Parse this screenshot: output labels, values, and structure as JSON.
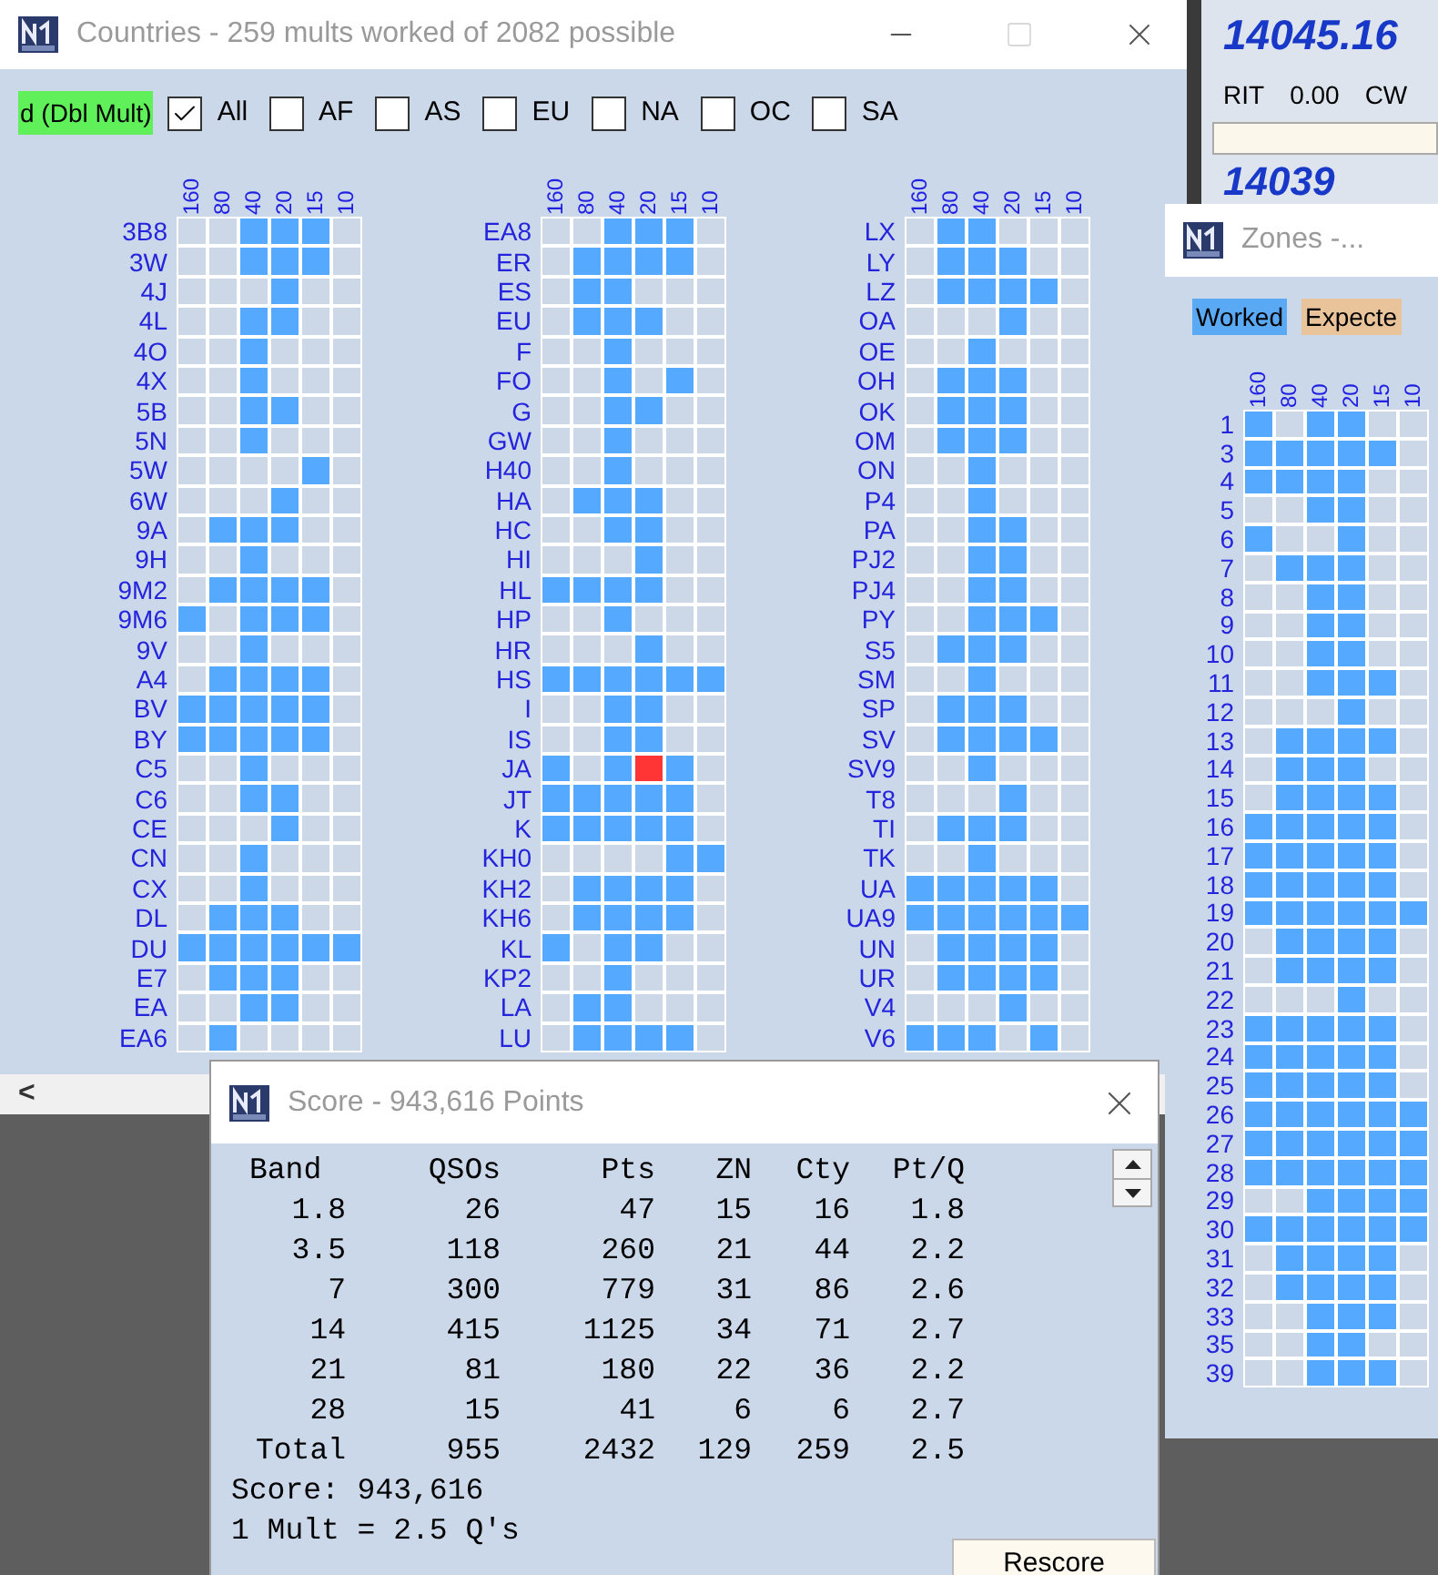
{
  "countries_window": {
    "title": "Countries - 259 mults worked of 2082 possible",
    "filter_label": "d (Dbl Mult)",
    "filters": [
      {
        "label": "All",
        "checked": true
      },
      {
        "label": "AF",
        "checked": false
      },
      {
        "label": "AS",
        "checked": false
      },
      {
        "label": "EU",
        "checked": false
      },
      {
        "label": "NA",
        "checked": false
      },
      {
        "label": "OC",
        "checked": false
      },
      {
        "label": "SA",
        "checked": false
      }
    ],
    "columns": [
      {
        "band_headers": [
          "160",
          "80",
          "40",
          "20",
          "15",
          "10"
        ],
        "rows": [
          {
            "name": "3B8",
            "worked": [
              false,
              false,
              true,
              true,
              true,
              false
            ]
          },
          {
            "name": "3W",
            "worked": [
              false,
              false,
              true,
              true,
              true,
              false
            ]
          },
          {
            "name": "4J",
            "worked": [
              false,
              false,
              false,
              true,
              false,
              false
            ]
          },
          {
            "name": "4L",
            "worked": [
              false,
              false,
              true,
              true,
              false,
              false
            ]
          },
          {
            "name": "4O",
            "worked": [
              false,
              false,
              true,
              false,
              false,
              false
            ]
          },
          {
            "name": "4X",
            "worked": [
              false,
              false,
              true,
              false,
              false,
              false
            ]
          },
          {
            "name": "5B",
            "worked": [
              false,
              false,
              true,
              true,
              false,
              false
            ]
          },
          {
            "name": "5N",
            "worked": [
              false,
              false,
              true,
              false,
              false,
              false
            ]
          },
          {
            "name": "5W",
            "worked": [
              false,
              false,
              false,
              false,
              true,
              false
            ]
          },
          {
            "name": "6W",
            "worked": [
              false,
              false,
              false,
              true,
              false,
              false
            ]
          },
          {
            "name": "9A",
            "worked": [
              false,
              true,
              true,
              true,
              false,
              false
            ]
          },
          {
            "name": "9H",
            "worked": [
              false,
              false,
              true,
              false,
              false,
              false
            ]
          },
          {
            "name": "9M2",
            "worked": [
              false,
              true,
              true,
              true,
              true,
              false
            ]
          },
          {
            "name": "9M6",
            "worked": [
              true,
              false,
              true,
              true,
              true,
              false
            ]
          },
          {
            "name": "9V",
            "worked": [
              false,
              false,
              true,
              false,
              false,
              false
            ]
          },
          {
            "name": "A4",
            "worked": [
              false,
              true,
              true,
              true,
              true,
              false
            ]
          },
          {
            "name": "BV",
            "worked": [
              true,
              true,
              true,
              true,
              true,
              false
            ]
          },
          {
            "name": "BY",
            "worked": [
              true,
              true,
              true,
              true,
              true,
              false
            ]
          },
          {
            "name": "C5",
            "worked": [
              false,
              false,
              true,
              false,
              false,
              false
            ]
          },
          {
            "name": "C6",
            "worked": [
              false,
              false,
              true,
              true,
              false,
              false
            ]
          },
          {
            "name": "CE",
            "worked": [
              false,
              false,
              false,
              true,
              false,
              false
            ]
          },
          {
            "name": "CN",
            "worked": [
              false,
              false,
              true,
              false,
              false,
              false
            ]
          },
          {
            "name": "CX",
            "worked": [
              false,
              false,
              true,
              false,
              false,
              false
            ]
          },
          {
            "name": "DL",
            "worked": [
              false,
              true,
              true,
              true,
              false,
              false
            ]
          },
          {
            "name": "DU",
            "worked": [
              true,
              true,
              true,
              true,
              true,
              true
            ]
          },
          {
            "name": "E7",
            "worked": [
              false,
              true,
              true,
              true,
              false,
              false
            ]
          },
          {
            "name": "EA",
            "worked": [
              false,
              false,
              true,
              true,
              false,
              false
            ]
          },
          {
            "name": "EA6",
            "worked": [
              false,
              true,
              false,
              false,
              false,
              false
            ]
          }
        ]
      },
      {
        "band_headers": [
          "160",
          "80",
          "40",
          "20",
          "15",
          "10"
        ],
        "rows": [
          {
            "name": "EA8",
            "worked": [
              false,
              false,
              true,
              true,
              true,
              false
            ]
          },
          {
            "name": "ER",
            "worked": [
              false,
              true,
              true,
              true,
              true,
              false
            ]
          },
          {
            "name": "ES",
            "worked": [
              false,
              true,
              true,
              false,
              false,
              false
            ]
          },
          {
            "name": "EU",
            "worked": [
              false,
              true,
              true,
              true,
              false,
              false
            ]
          },
          {
            "name": "F",
            "worked": [
              false,
              false,
              true,
              false,
              false,
              false
            ]
          },
          {
            "name": "FO",
            "worked": [
              false,
              false,
              true,
              false,
              true,
              false
            ]
          },
          {
            "name": "G",
            "worked": [
              false,
              false,
              true,
              true,
              false,
              false
            ]
          },
          {
            "name": "GW",
            "worked": [
              false,
              false,
              true,
              false,
              false,
              false
            ]
          },
          {
            "name": "H40",
            "worked": [
              false,
              false,
              true,
              false,
              false,
              false
            ]
          },
          {
            "name": "HA",
            "worked": [
              false,
              true,
              true,
              true,
              false,
              false
            ]
          },
          {
            "name": "HC",
            "worked": [
              false,
              false,
              true,
              true,
              false,
              false
            ]
          },
          {
            "name": "HI",
            "worked": [
              false,
              false,
              false,
              true,
              false,
              false
            ]
          },
          {
            "name": "HL",
            "worked": [
              true,
              true,
              true,
              true,
              false,
              false
            ]
          },
          {
            "name": "HP",
            "worked": [
              false,
              false,
              true,
              false,
              false,
              false
            ]
          },
          {
            "name": "HR",
            "worked": [
              false,
              false,
              false,
              true,
              false,
              false
            ]
          },
          {
            "name": "HS",
            "worked": [
              true,
              true,
              true,
              true,
              true,
              true
            ]
          },
          {
            "name": "I",
            "worked": [
              false,
              false,
              true,
              true,
              false,
              false
            ]
          },
          {
            "name": "IS",
            "worked": [
              false,
              false,
              true,
              true,
              false,
              false
            ]
          },
          {
            "name": "JA",
            "worked": [
              true,
              false,
              true,
              true,
              true,
              false
            ],
            "flagged": [
              false,
              false,
              false,
              true,
              false,
              false
            ]
          },
          {
            "name": "JT",
            "worked": [
              true,
              true,
              true,
              true,
              true,
              false
            ]
          },
          {
            "name": "K",
            "worked": [
              true,
              true,
              true,
              true,
              true,
              false
            ]
          },
          {
            "name": "KH0",
            "worked": [
              false,
              false,
              false,
              false,
              true,
              true
            ]
          },
          {
            "name": "KH2",
            "worked": [
              false,
              true,
              true,
              true,
              true,
              false
            ]
          },
          {
            "name": "KH6",
            "worked": [
              false,
              true,
              true,
              true,
              true,
              false
            ]
          },
          {
            "name": "KL",
            "worked": [
              true,
              false,
              true,
              true,
              false,
              false
            ]
          },
          {
            "name": "KP2",
            "worked": [
              false,
              false,
              true,
              false,
              false,
              false
            ]
          },
          {
            "name": "LA",
            "worked": [
              false,
              true,
              true,
              false,
              false,
              false
            ]
          },
          {
            "name": "LU",
            "worked": [
              false,
              true,
              true,
              true,
              true,
              false
            ]
          }
        ]
      },
      {
        "band_headers": [
          "160",
          "80",
          "40",
          "20",
          "15",
          "10"
        ],
        "rows": [
          {
            "name": "LX",
            "worked": [
              false,
              true,
              true,
              false,
              false,
              false
            ]
          },
          {
            "name": "LY",
            "worked": [
              false,
              true,
              true,
              true,
              false,
              false
            ]
          },
          {
            "name": "LZ",
            "worked": [
              false,
              true,
              true,
              true,
              true,
              false
            ]
          },
          {
            "name": "OA",
            "worked": [
              false,
              false,
              false,
              true,
              false,
              false
            ]
          },
          {
            "name": "OE",
            "worked": [
              false,
              false,
              true,
              false,
              false,
              false
            ]
          },
          {
            "name": "OH",
            "worked": [
              false,
              true,
              true,
              true,
              false,
              false
            ]
          },
          {
            "name": "OK",
            "worked": [
              false,
              true,
              true,
              true,
              false,
              false
            ]
          },
          {
            "name": "OM",
            "worked": [
              false,
              true,
              true,
              true,
              false,
              false
            ]
          },
          {
            "name": "ON",
            "worked": [
              false,
              false,
              true,
              false,
              false,
              false
            ]
          },
          {
            "name": "P4",
            "worked": [
              false,
              false,
              true,
              false,
              false,
              false
            ]
          },
          {
            "name": "PA",
            "worked": [
              false,
              false,
              true,
              true,
              false,
              false
            ]
          },
          {
            "name": "PJ2",
            "worked": [
              false,
              false,
              true,
              true,
              false,
              false
            ]
          },
          {
            "name": "PJ4",
            "worked": [
              false,
              false,
              true,
              true,
              false,
              false
            ]
          },
          {
            "name": "PY",
            "worked": [
              false,
              false,
              true,
              true,
              true,
              false
            ]
          },
          {
            "name": "S5",
            "worked": [
              false,
              true,
              true,
              true,
              false,
              false
            ]
          },
          {
            "name": "SM",
            "worked": [
              false,
              false,
              true,
              false,
              false,
              false
            ]
          },
          {
            "name": "SP",
            "worked": [
              false,
              true,
              true,
              true,
              false,
              false
            ]
          },
          {
            "name": "SV",
            "worked": [
              false,
              true,
              true,
              true,
              true,
              false
            ]
          },
          {
            "name": "SV9",
            "worked": [
              false,
              false,
              true,
              false,
              false,
              false
            ]
          },
          {
            "name": "T8",
            "worked": [
              false,
              false,
              false,
              true,
              false,
              false
            ]
          },
          {
            "name": "TI",
            "worked": [
              false,
              true,
              true,
              true,
              false,
              false
            ]
          },
          {
            "name": "TK",
            "worked": [
              false,
              false,
              true,
              false,
              false,
              false
            ]
          },
          {
            "name": "UA",
            "worked": [
              true,
              true,
              true,
              true,
              true,
              false
            ]
          },
          {
            "name": "UA9",
            "worked": [
              true,
              true,
              true,
              true,
              true,
              true
            ]
          },
          {
            "name": "UN",
            "worked": [
              false,
              true,
              true,
              true,
              true,
              false
            ]
          },
          {
            "name": "UR",
            "worked": [
              false,
              true,
              true,
              true,
              true,
              false
            ]
          },
          {
            "name": "V4",
            "worked": [
              false,
              false,
              false,
              true,
              false,
              false
            ]
          },
          {
            "name": "V6",
            "worked": [
              true,
              true,
              true,
              false,
              true,
              false
            ]
          }
        ]
      }
    ],
    "scroll_left": "<"
  },
  "radio_panel": {
    "frequency": "14045.16",
    "rit_label": "RIT",
    "rit_value": "0.00",
    "mode": "CW",
    "second_frequency": "14039"
  },
  "zones_window": {
    "title": "Zones -...",
    "legend": [
      {
        "label": "Worked",
        "color": "#5aa9f5"
      },
      {
        "label": "Expecte",
        "color": "#e9c39a"
      }
    ],
    "band_headers": [
      "160",
      "80",
      "40",
      "20",
      "15",
      "10"
    ],
    "rows": [
      {
        "name": "1",
        "worked": [
          true,
          false,
          true,
          true,
          false,
          false
        ]
      },
      {
        "name": "3",
        "worked": [
          true,
          true,
          true,
          true,
          true,
          false
        ]
      },
      {
        "name": "4",
        "worked": [
          true,
          true,
          true,
          true,
          false,
          false
        ]
      },
      {
        "name": "5",
        "worked": [
          false,
          false,
          true,
          true,
          false,
          false
        ]
      },
      {
        "name": "6",
        "worked": [
          true,
          false,
          false,
          true,
          false,
          false
        ]
      },
      {
        "name": "7",
        "worked": [
          false,
          true,
          true,
          true,
          false,
          false
        ]
      },
      {
        "name": "8",
        "worked": [
          false,
          false,
          true,
          true,
          false,
          false
        ]
      },
      {
        "name": "9",
        "worked": [
          false,
          false,
          true,
          true,
          false,
          false
        ]
      },
      {
        "name": "10",
        "worked": [
          false,
          false,
          true,
          true,
          false,
          false
        ]
      },
      {
        "name": "11",
        "worked": [
          false,
          false,
          true,
          true,
          true,
          false
        ]
      },
      {
        "name": "12",
        "worked": [
          false,
          false,
          false,
          true,
          false,
          false
        ]
      },
      {
        "name": "13",
        "worked": [
          false,
          true,
          true,
          true,
          true,
          false
        ]
      },
      {
        "name": "14",
        "worked": [
          false,
          true,
          true,
          true,
          false,
          false
        ]
      },
      {
        "name": "15",
        "worked": [
          false,
          true,
          true,
          true,
          true,
          false
        ]
      },
      {
        "name": "16",
        "worked": [
          true,
          true,
          true,
          true,
          true,
          false
        ]
      },
      {
        "name": "17",
        "worked": [
          true,
          true,
          true,
          true,
          true,
          false
        ]
      },
      {
        "name": "18",
        "worked": [
          true,
          true,
          true,
          true,
          true,
          false
        ]
      },
      {
        "name": "19",
        "worked": [
          true,
          true,
          true,
          true,
          true,
          true
        ]
      },
      {
        "name": "20",
        "worked": [
          false,
          true,
          true,
          true,
          true,
          false
        ]
      },
      {
        "name": "21",
        "worked": [
          false,
          true,
          true,
          true,
          true,
          false
        ]
      },
      {
        "name": "22",
        "worked": [
          false,
          false,
          false,
          true,
          false,
          false
        ]
      },
      {
        "name": "23",
        "worked": [
          true,
          true,
          true,
          true,
          true,
          false
        ]
      },
      {
        "name": "24",
        "worked": [
          true,
          true,
          true,
          true,
          true,
          false
        ]
      },
      {
        "name": "25",
        "worked": [
          true,
          true,
          true,
          true,
          true,
          false
        ]
      },
      {
        "name": "26",
        "worked": [
          true,
          true,
          true,
          true,
          true,
          true
        ]
      },
      {
        "name": "27",
        "worked": [
          true,
          true,
          true,
          true,
          true,
          true
        ]
      },
      {
        "name": "28",
        "worked": [
          true,
          true,
          true,
          true,
          true,
          true
        ]
      },
      {
        "name": "29",
        "worked": [
          false,
          false,
          true,
          true,
          true,
          true
        ]
      },
      {
        "name": "30",
        "worked": [
          true,
          true,
          true,
          true,
          true,
          true
        ]
      },
      {
        "name": "31",
        "worked": [
          false,
          true,
          true,
          true,
          true,
          false
        ]
      },
      {
        "name": "32",
        "worked": [
          false,
          true,
          true,
          true,
          true,
          false
        ]
      },
      {
        "name": "33",
        "worked": [
          false,
          false,
          true,
          true,
          true,
          false
        ]
      },
      {
        "name": "35",
        "worked": [
          false,
          false,
          true,
          true,
          false,
          false
        ]
      },
      {
        "name": "39",
        "worked": [
          false,
          false,
          true,
          true,
          true,
          false
        ]
      }
    ]
  },
  "score_window": {
    "title": "Score - 943,616 Points",
    "columns": [
      "Band",
      "QSOs",
      "Pts",
      "ZN",
      "Cty",
      "Pt/Q"
    ],
    "rows": [
      [
        "1.8",
        "26",
        "47",
        "15",
        "16",
        "1.8"
      ],
      [
        "3.5",
        "118",
        "260",
        "21",
        "44",
        "2.2"
      ],
      [
        "7",
        "300",
        "779",
        "31",
        "86",
        "2.6"
      ],
      [
        "14",
        "415",
        "1125",
        "34",
        "71",
        "2.7"
      ],
      [
        "21",
        "81",
        "180",
        "22",
        "36",
        "2.2"
      ],
      [
        "28",
        "15",
        "41",
        "6",
        "6",
        "2.7"
      ],
      [
        "Total",
        "955",
        "2432",
        "129",
        "259",
        "2.5"
      ]
    ],
    "score_line": "Score: 943,616",
    "mult_line": "1 Mult = 2.5 Q's",
    "button": "Rescore"
  }
}
